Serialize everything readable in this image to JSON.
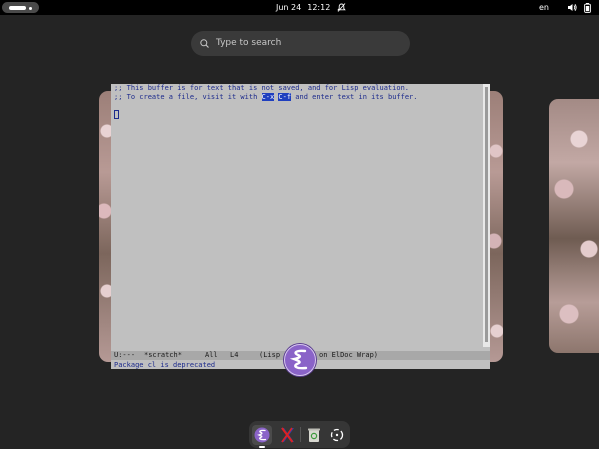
{
  "topbar": {
    "date": "Jun 24",
    "time": "12:12",
    "language": "en"
  },
  "search": {
    "placeholder": "Type to search"
  },
  "emacs": {
    "line1": ";; This buffer is for text that is not saved, and for Lisp evaluation.",
    "line2_before": ";; To create a file, visit it with ",
    "line2_key1": "C-x",
    "line2_key2": "C-f",
    "line2_after": " and enter text in its buffer.",
    "modeline": {
      "status": "U:---",
      "buffer": "*scratch*",
      "position": "All",
      "line": "L4",
      "mode_left": "(Lisp",
      "mode_right": "on ElDoc Wrap)"
    },
    "echo": "Package cl is deprecated"
  },
  "dock": {
    "apps": [
      "emacs-icon",
      "x-app-icon",
      "trash-icon",
      "app-grid-icon"
    ]
  }
}
